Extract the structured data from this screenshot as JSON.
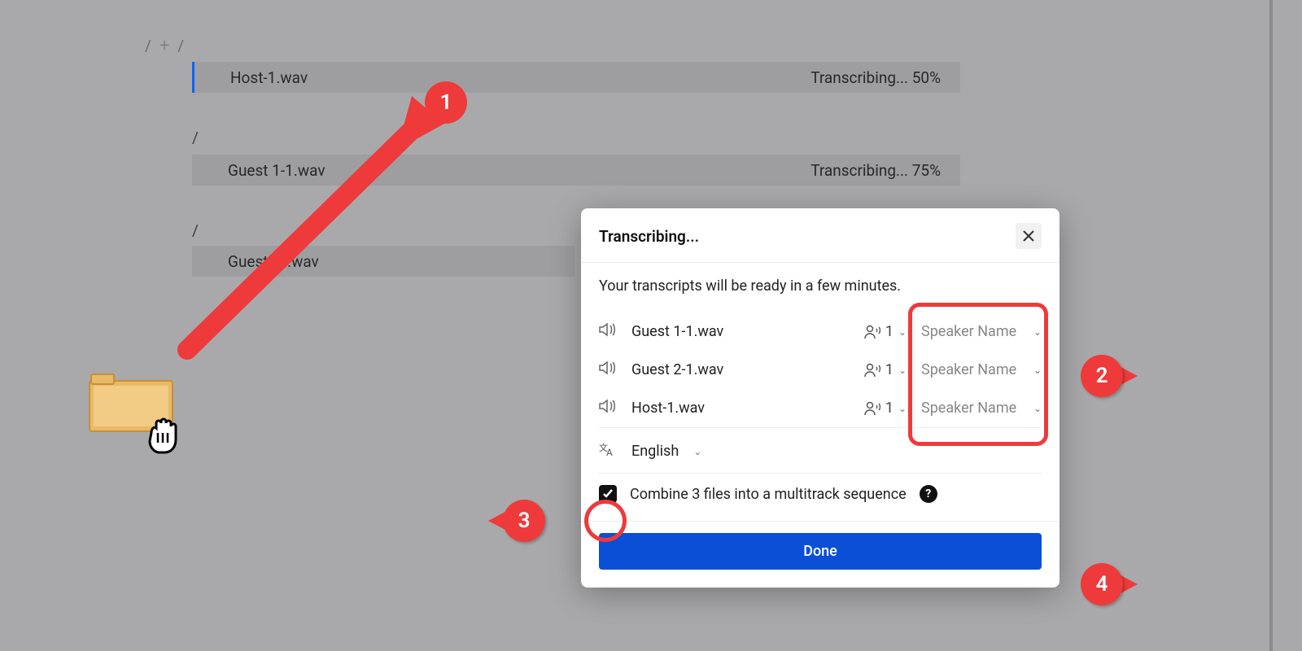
{
  "breadcrumb": {
    "slash1": "/",
    "slash2": "/"
  },
  "rows": [
    {
      "name": "Host-1.wav",
      "status": "Transcribing... 50%"
    },
    {
      "name": "Guest 1-1.wav",
      "status": "Transcribing... 75%"
    },
    {
      "name": "Guest 2-1.wav",
      "status": ""
    }
  ],
  "row_labels": {
    "slash": "/"
  },
  "modal": {
    "title": "Transcribing...",
    "subtext": "Your transcripts will be ready in a few minutes.",
    "files": [
      {
        "name": "Guest 1-1.wav",
        "count": "1",
        "speaker": "Speaker Name"
      },
      {
        "name": "Guest 2-1.wav",
        "count": "1",
        "speaker": "Speaker Name"
      },
      {
        "name": "Host-1.wav",
        "count": "1",
        "speaker": "Speaker Name"
      }
    ],
    "language": "English",
    "combine_label": "Combine 3 files into a multitrack sequence",
    "done": "Done"
  },
  "annotations": {
    "a1": "1",
    "a2": "2",
    "a3": "3",
    "a4": "4"
  }
}
